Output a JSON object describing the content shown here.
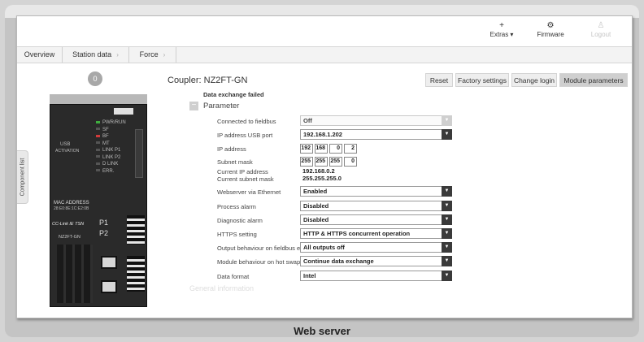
{
  "top_bar": {
    "extras": {
      "label": "Extras ▾",
      "icon": "plus-icon"
    },
    "firmware": {
      "label": "Firmware",
      "icon": "gear-icon"
    },
    "logout": {
      "label": "Logout",
      "icon": "user-icon"
    }
  },
  "nav": {
    "tabs": [
      {
        "label": "Overview"
      },
      {
        "label": "Station data"
      },
      {
        "label": "Force"
      }
    ]
  },
  "side_panel": {
    "label": "Component list"
  },
  "device": {
    "badge_number": "0",
    "leds_left": [
      "PWR/RUN",
      "SF",
      "BF",
      "MT",
      "LINK P1",
      "LINK P2",
      "D LINK",
      "ERR."
    ],
    "usb_label": "USB",
    "activation_label": "ACTIVATION",
    "mac_label": "MAC ADDRESS",
    "mac_value": "28:E0:8E:1C:E2:0B",
    "series_label": "CC-Link IE TSN",
    "model": "NZ2FT-GN",
    "port1": "P1",
    "port2": "P2"
  },
  "main": {
    "title": "Coupler: NZ2FT-GN",
    "status": "Data exchange failed",
    "buttons": [
      {
        "label": "Reset"
      },
      {
        "label": "Factory settings"
      },
      {
        "label": "Change login"
      },
      {
        "label": "Module parameters"
      }
    ],
    "section_title": "Parameter",
    "params": {
      "connected_fieldbus": {
        "label": "Connected to fieldbus",
        "value": "Off"
      },
      "ip_usb": {
        "label": "IP address USB port",
        "value": "192.168.1.202"
      },
      "ip_address": {
        "label": "IP address",
        "octets": [
          "192",
          "168",
          "0",
          "2"
        ]
      },
      "subnet": {
        "label": "Subnet mask",
        "octets": [
          "255",
          "255",
          "255",
          "0"
        ]
      },
      "current_ip": {
        "label": "Current IP address",
        "value": "192.168.0.2"
      },
      "current_subnet": {
        "label": "Current subnet mask",
        "value": "255.255.255.0"
      },
      "webserver": {
        "label": "Webserver via Ethernet",
        "value": "Enabled"
      },
      "process_alarm": {
        "label": "Process alarm",
        "value": "Disabled"
      },
      "diagnostic_alarm": {
        "label": "Diagnostic alarm",
        "value": "Disabled"
      },
      "https": {
        "label": "HTTPS setting",
        "value": "HTTP & HTTPS concurrent operation"
      },
      "output_behaviour": {
        "label": "Output behaviour on fieldbus error",
        "value": "All outputs off"
      },
      "module_behaviour": {
        "label": "Module behaviour on hot swap",
        "value": "Continue data exchange"
      },
      "data_format": {
        "label": "Data format",
        "value": "Intel"
      }
    },
    "next_section": "General information"
  },
  "caption": "Web server"
}
